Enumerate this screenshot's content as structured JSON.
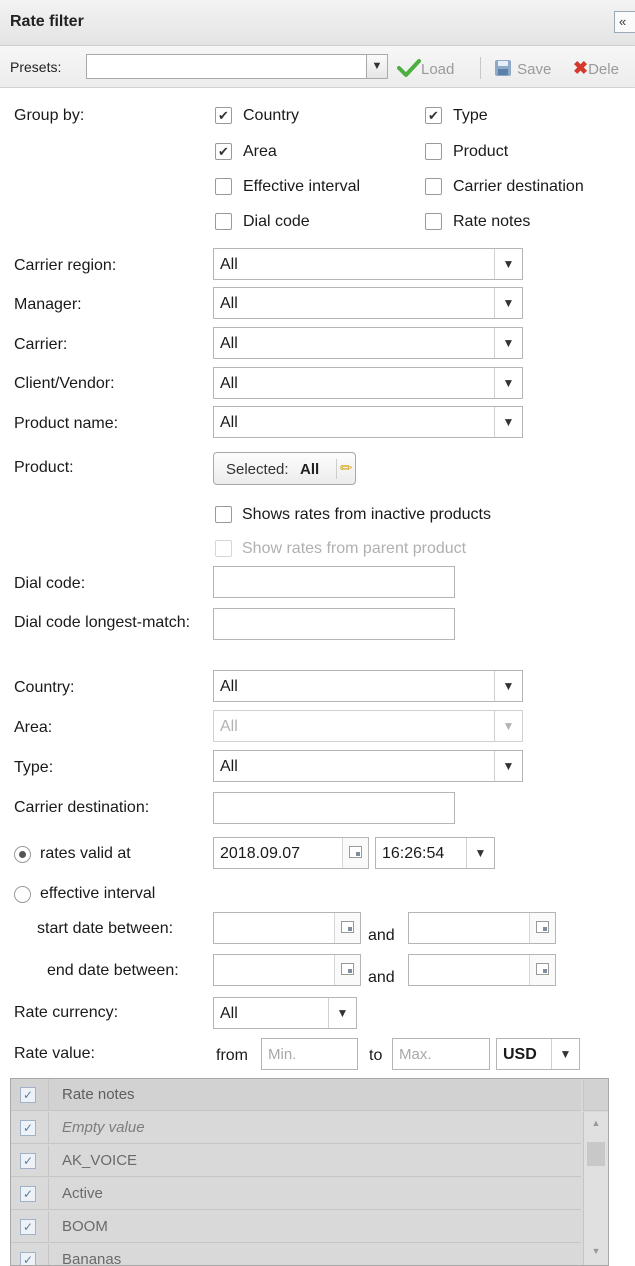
{
  "panel": {
    "title": "Rate filter",
    "collapse_icon": "«"
  },
  "presets": {
    "label": "Presets:",
    "value": "",
    "load": "Load",
    "save": "Save",
    "delete": "Dele"
  },
  "group_by": {
    "label": "Group by:",
    "options": [
      {
        "label": "Country",
        "checked": "✔"
      },
      {
        "label": "Type",
        "checked": "✔"
      },
      {
        "label": "Area",
        "checked": "✔"
      },
      {
        "label": "Product",
        "checked": ""
      },
      {
        "label": "Effective interval",
        "checked": ""
      },
      {
        "label": "Carrier destination",
        "checked": ""
      },
      {
        "label": "Dial code",
        "checked": ""
      },
      {
        "label": "Rate notes",
        "checked": ""
      }
    ]
  },
  "filters": {
    "carrier_region": {
      "label": "Carrier region:",
      "value": "All"
    },
    "manager": {
      "label": "Manager:",
      "value": "All"
    },
    "carrier": {
      "label": "Carrier:",
      "value": "All"
    },
    "client_vendor": {
      "label": "Client/Vendor:",
      "value": "All"
    },
    "product_name": {
      "label": "Product name:",
      "value": "All"
    },
    "product": {
      "label": "Product:",
      "selected_prefix": "Selected:",
      "selected_value": "All"
    },
    "inactive_products": {
      "label": "Shows rates from inactive products",
      "checked": ""
    },
    "parent_product": {
      "label": "Show rates from parent product",
      "checked": ""
    },
    "dial_code": {
      "label": "Dial code:",
      "value": ""
    },
    "dial_code_longest": {
      "label": "Dial code longest-match:",
      "value": ""
    },
    "country": {
      "label": "Country:",
      "value": "All"
    },
    "area": {
      "label": "Area:",
      "value": "All"
    },
    "type": {
      "label": "Type:",
      "value": "All"
    },
    "carrier_destination": {
      "label": "Carrier destination:",
      "value": ""
    }
  },
  "validity": {
    "rates_valid_at": {
      "label": "rates valid at",
      "date": "2018.09.07",
      "time": "16:26:54"
    },
    "effective_interval": {
      "label": "effective interval"
    },
    "start_between": {
      "label": "start date between:",
      "and": "and"
    },
    "end_between": {
      "label": "end date between:",
      "and": "and"
    }
  },
  "rate_currency": {
    "label": "Rate currency:",
    "value": "All"
  },
  "rate_value": {
    "label": "Rate value:",
    "from": "from",
    "min_placeholder": "Min.",
    "to": "to",
    "max_placeholder": "Max.",
    "currency": "USD"
  },
  "rate_notes_grid": {
    "header": "Rate notes",
    "rows": [
      "Empty value",
      "AK_VOICE",
      "Active",
      "BOOM",
      "Bananas"
    ]
  }
}
